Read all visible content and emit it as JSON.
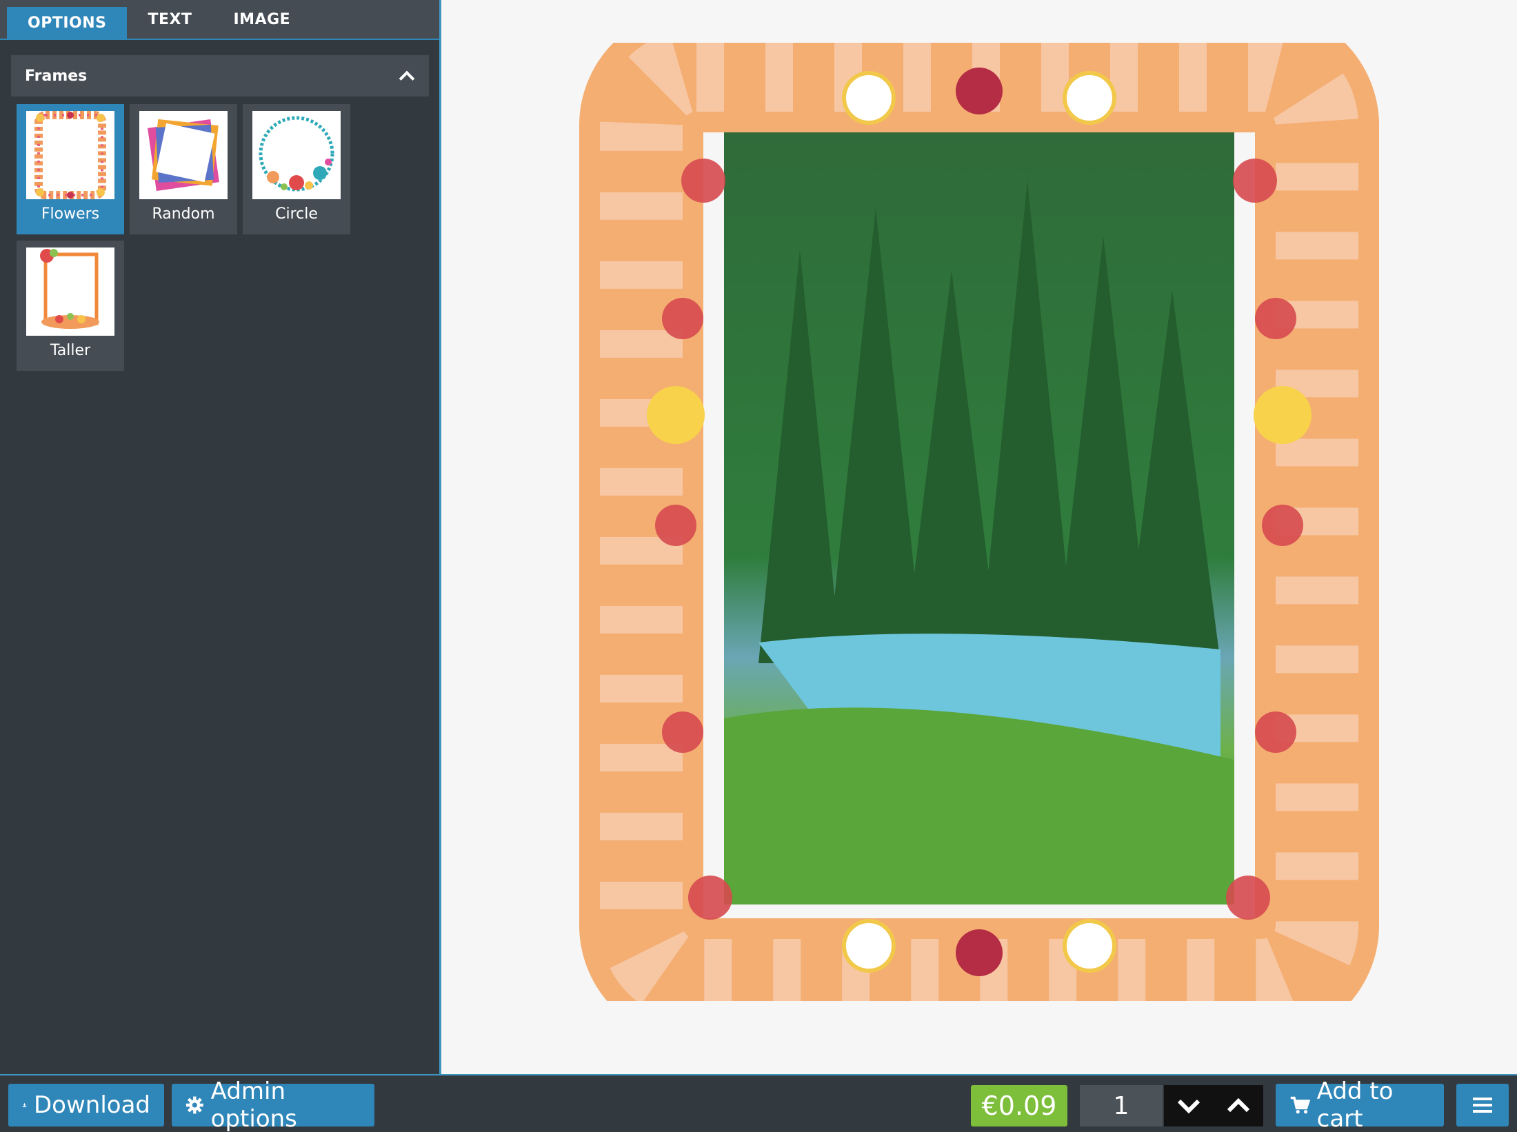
{
  "tabs": [
    {
      "label": "OPTIONS",
      "active": true
    },
    {
      "label": "TEXT",
      "active": false
    },
    {
      "label": "IMAGE",
      "active": false
    }
  ],
  "panel": {
    "title": "Frames",
    "expanded": true
  },
  "frames": [
    {
      "label": "Flowers",
      "selected": true
    },
    {
      "label": "Random",
      "selected": false
    },
    {
      "label": "Circle",
      "selected": false
    },
    {
      "label": "Taller",
      "selected": false
    }
  ],
  "toolbar": {
    "download_label": "Download",
    "admin_label": "Admin options",
    "price": "€0.09",
    "quantity": "1",
    "add_to_cart_label": "Add to cart"
  },
  "icons": {
    "download": "download-icon",
    "admin": "gear-icon",
    "cart": "cart-icon",
    "menu": "hamburger-icon",
    "qty_down": "chevron-down-icon",
    "qty_up": "chevron-up-icon",
    "collapse": "chevron-up-icon"
  },
  "colors": {
    "accent": "#2f86b8",
    "sidebar": "#32393f",
    "panel": "#454c53",
    "price": "#7dbe3a"
  }
}
